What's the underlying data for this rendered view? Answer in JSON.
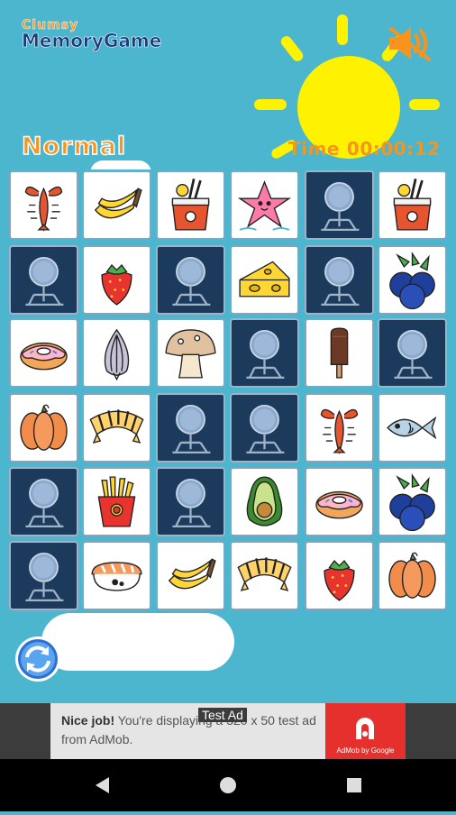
{
  "app": {
    "logo_line1": "Clumsy",
    "logo_line2": "MemoryGame",
    "mode": "Normal",
    "timer_label": "Time",
    "timer_value": "00:00:12"
  },
  "board": {
    "rows": 6,
    "cols": 6,
    "cards": [
      [
        "crayfish",
        "banana",
        "noodles",
        "starfish",
        "back",
        "noodles"
      ],
      [
        "back",
        "strawberry",
        "back",
        "cheese",
        "back",
        "blueberry"
      ],
      [
        "donut",
        "onion",
        "mushroom",
        "back",
        "icecream",
        "back"
      ],
      [
        "pumpkin",
        "croissant",
        "back",
        "back",
        "crayfish",
        "fish"
      ],
      [
        "back",
        "fries",
        "back",
        "avocado",
        "donut",
        "blueberry"
      ],
      [
        "back",
        "sushi",
        "banana",
        "croissant",
        "strawberry",
        "pumpkin"
      ]
    ]
  },
  "icons": {
    "sound": "speaker-muted-icon",
    "refresh": "refresh-icon"
  },
  "ad": {
    "label": "Test Ad",
    "bold": "Nice job!",
    "text": " You're displaying a 320 x 50 test ad from AdMob.",
    "brand": "AdMob by Google"
  },
  "colors": {
    "background": "#4cb6cf",
    "accent": "#f7941d",
    "sun": "#fff200",
    "card_back": "#1b3a5c"
  }
}
